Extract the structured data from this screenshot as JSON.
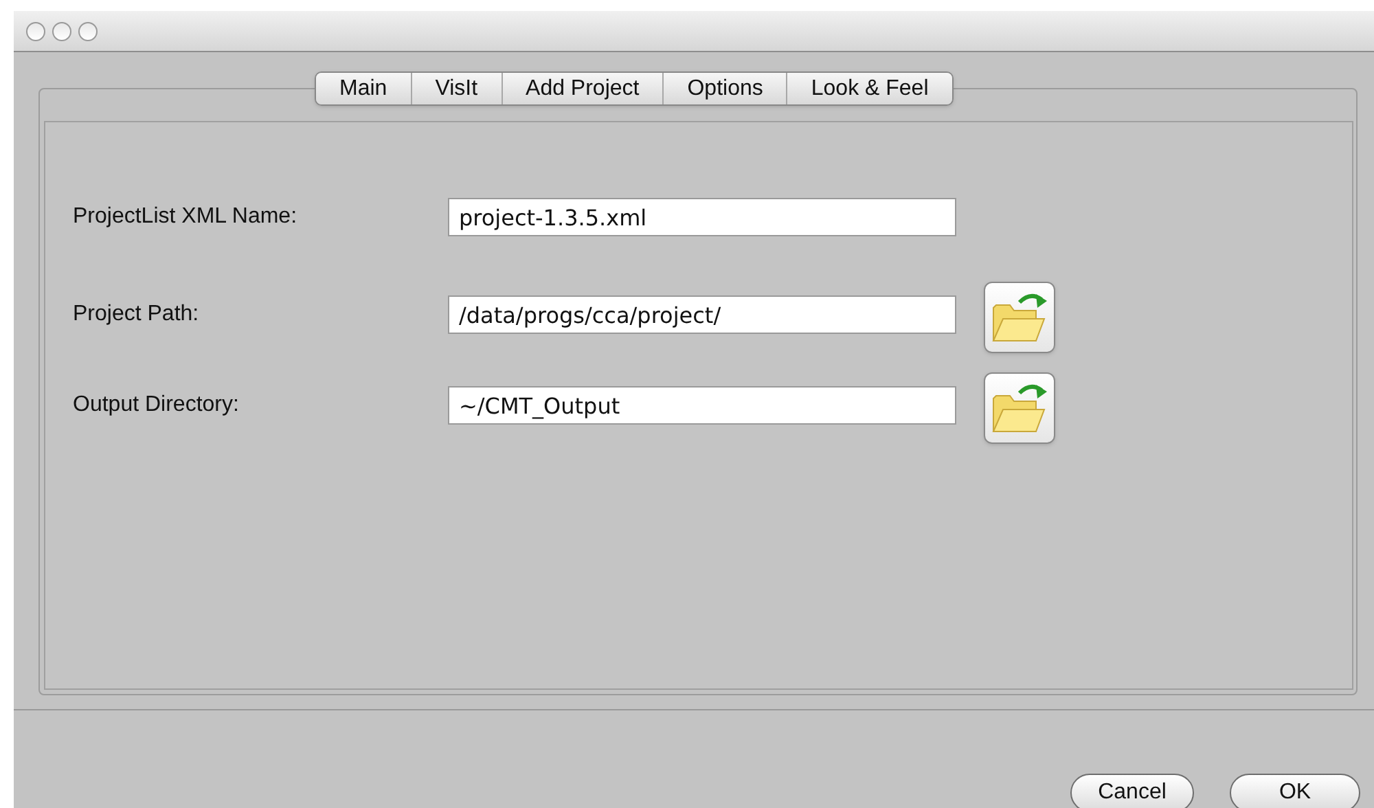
{
  "tabs": [
    {
      "label": "Main"
    },
    {
      "label": "VisIt"
    },
    {
      "label": "Add Project"
    },
    {
      "label": "Options"
    },
    {
      "label": "Look & Feel"
    }
  ],
  "fields": [
    {
      "label": "ProjectList XML Name:",
      "value": "project-1.3.5.xml",
      "browse": false
    },
    {
      "label": "Project Path:",
      "value": "/data/progs/cca/project/",
      "browse": true
    },
    {
      "label": "Output Directory:",
      "value": "~/CMT_Output",
      "browse": true
    }
  ],
  "buttons": [
    "Cancel",
    "OK"
  ]
}
